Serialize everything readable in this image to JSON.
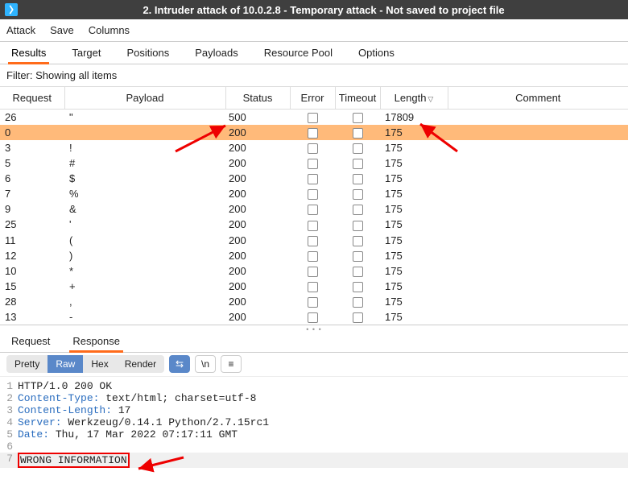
{
  "window": {
    "title": "2. Intruder attack of 10.0.2.8 - Temporary attack - Not saved to project file"
  },
  "menubar": {
    "attack": "Attack",
    "save": "Save",
    "columns": "Columns"
  },
  "tabs": {
    "results": "Results",
    "target": "Target",
    "positions": "Positions",
    "payloads": "Payloads",
    "resource": "Resource Pool",
    "options": "Options"
  },
  "filter": "Filter: Showing all items",
  "columns": {
    "request": "Request",
    "payload": "Payload",
    "status": "Status",
    "error": "Error",
    "timeout": "Timeout",
    "length": "Length",
    "comment": "Comment"
  },
  "rows": [
    {
      "req": "26",
      "payload": "\"",
      "status": "500",
      "length": "17809",
      "selected": false
    },
    {
      "req": "0",
      "payload": "",
      "status": "200",
      "length": "175",
      "selected": true
    },
    {
      "req": "3",
      "payload": "!",
      "status": "200",
      "length": "175",
      "selected": false
    },
    {
      "req": "5",
      "payload": "#",
      "status": "200",
      "length": "175",
      "selected": false
    },
    {
      "req": "6",
      "payload": "$",
      "status": "200",
      "length": "175",
      "selected": false
    },
    {
      "req": "7",
      "payload": "%",
      "status": "200",
      "length": "175",
      "selected": false
    },
    {
      "req": "9",
      "payload": "&",
      "status": "200",
      "length": "175",
      "selected": false
    },
    {
      "req": "25",
      "payload": "'",
      "status": "200",
      "length": "175",
      "selected": false
    },
    {
      "req": "11",
      "payload": "(",
      "status": "200",
      "length": "175",
      "selected": false
    },
    {
      "req": "12",
      "payload": ")",
      "status": "200",
      "length": "175",
      "selected": false
    },
    {
      "req": "10",
      "payload": "*",
      "status": "200",
      "length": "175",
      "selected": false
    },
    {
      "req": "15",
      "payload": "+",
      "status": "200",
      "length": "175",
      "selected": false
    },
    {
      "req": "28",
      "payload": ",",
      "status": "200",
      "length": "175",
      "selected": false
    },
    {
      "req": "13",
      "payload": "-",
      "status": "200",
      "length": "175",
      "selected": false
    }
  ],
  "detailTabs": {
    "request": "Request",
    "response": "Response"
  },
  "viewModes": {
    "pretty": "Pretty",
    "raw": "Raw",
    "hex": "Hex",
    "render": "Render",
    "wrap": "⇆",
    "newline": "\\n",
    "menu": "≡"
  },
  "response": {
    "lines": [
      {
        "n": "1",
        "plain": "HTTP/1.0 200 OK"
      },
      {
        "n": "2",
        "key": "Content-Type:",
        "rest": " text/html; charset=utf-8"
      },
      {
        "n": "3",
        "key": "Content-Length:",
        "rest": " 17"
      },
      {
        "n": "4",
        "key": "Server:",
        "rest": " Werkzeug/0.14.1 Python/2.7.15rc1"
      },
      {
        "n": "5",
        "key": "Date:",
        "rest": " Thu, 17 Mar 2022 07:17:11 GMT"
      },
      {
        "n": "6",
        "plain": ""
      },
      {
        "n": "7",
        "highlight": "WRONG INFORMATION"
      }
    ]
  }
}
